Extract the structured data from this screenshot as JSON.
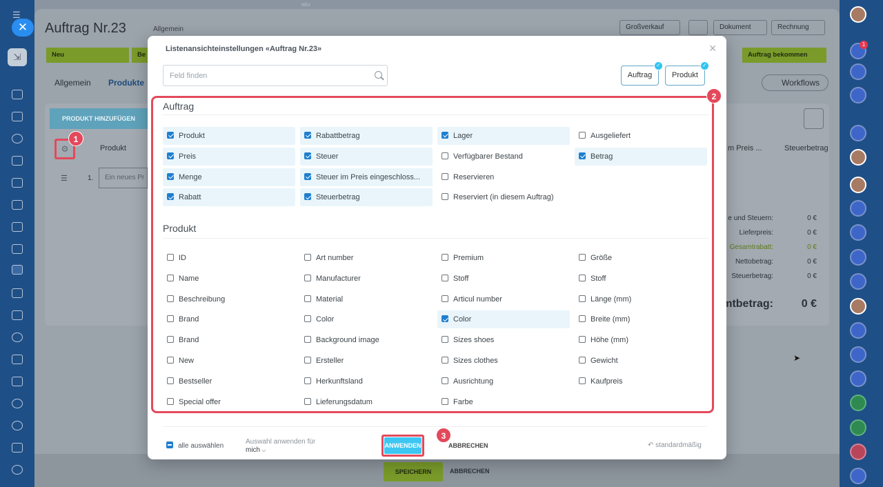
{
  "page": {
    "title": "Auftrag Nr.23",
    "category": "Allgemein",
    "top_center": "NEU",
    "pipeline": "Großverkauf",
    "document": "Dokument",
    "invoice": "Rechnung",
    "stages": [
      "Neu",
      "Be",
      "Auftrag bekommen"
    ],
    "tabs": [
      "Allgemein",
      "Produkte"
    ],
    "workflows": "Workflows",
    "add_product": "PRODUKT HINZUFÜGEN",
    "col_product": "Produkt",
    "col_price": "m Preis ...",
    "col_tax": "Steuerbetrag",
    "row_number": "1.",
    "row_placeholder": "Ein neues Pr",
    "summary": [
      {
        "label": "e und Steuern:",
        "value": "0 €"
      },
      {
        "label": "Lieferpreis:",
        "value": "0 €"
      },
      {
        "label": "Gesamtrabatt:",
        "value": "0 €"
      },
      {
        "label": "Nettobetrag:",
        "value": "0 €"
      },
      {
        "label": "Steuerbetrag:",
        "value": "0 €"
      }
    ],
    "total_label": "mtbetrag:",
    "total_value": "0 €",
    "save": "SPEICHERN",
    "cancel": "ABBRECHEN"
  },
  "modal": {
    "title": "Listenansichteinstellungen «Auftrag Nr.23»",
    "search_placeholder": "Feld finden",
    "tag_buttons": [
      "Auftrag",
      "Produkt"
    ],
    "sections": [
      {
        "title": "Auftrag",
        "items": [
          {
            "label": "Produkt",
            "checked": true
          },
          {
            "label": "Rabattbetrag",
            "checked": true
          },
          {
            "label": "Lager",
            "checked": true
          },
          {
            "label": "Ausgeliefert",
            "checked": false
          },
          {
            "label": "Preis",
            "checked": true
          },
          {
            "label": "Steuer",
            "checked": true
          },
          {
            "label": "Verfügbarer Bestand",
            "checked": false
          },
          {
            "label": "Betrag",
            "checked": true
          },
          {
            "label": "Menge",
            "checked": true
          },
          {
            "label": "Steuer im Preis eingeschloss...",
            "checked": true
          },
          {
            "label": "Reservieren",
            "checked": false
          },
          {
            "label": "",
            "checked": false
          },
          {
            "label": "Rabatt",
            "checked": true
          },
          {
            "label": "Steuerbetrag",
            "checked": true
          },
          {
            "label": "Reserviert (in diesem Auftrag)",
            "checked": false
          }
        ]
      },
      {
        "title": "Produkt",
        "items": [
          {
            "label": "ID",
            "checked": false
          },
          {
            "label": "Art number",
            "checked": false
          },
          {
            "label": "Premium",
            "checked": false
          },
          {
            "label": "Größe",
            "checked": false
          },
          {
            "label": "Name",
            "checked": false
          },
          {
            "label": "Manufacturer",
            "checked": false
          },
          {
            "label": "Stoff",
            "checked": false
          },
          {
            "label": "Stoff",
            "checked": false
          },
          {
            "label": "Beschreibung",
            "checked": false
          },
          {
            "label": "Material",
            "checked": false
          },
          {
            "label": "Articul number",
            "checked": false
          },
          {
            "label": "Länge (mm)",
            "checked": false
          },
          {
            "label": "Brand",
            "checked": false
          },
          {
            "label": "Color",
            "checked": false
          },
          {
            "label": "Color",
            "checked": true
          },
          {
            "label": "Breite (mm)",
            "checked": false
          },
          {
            "label": "Brand",
            "checked": false
          },
          {
            "label": "Background image",
            "checked": false
          },
          {
            "label": "Sizes shoes",
            "checked": false
          },
          {
            "label": "Höhe (mm)",
            "checked": false
          },
          {
            "label": "New",
            "checked": false
          },
          {
            "label": "Ersteller",
            "checked": false
          },
          {
            "label": "Sizes clothes",
            "checked": false
          },
          {
            "label": "Gewicht",
            "checked": false
          },
          {
            "label": "Bestseller",
            "checked": false
          },
          {
            "label": "Herkunftsland",
            "checked": false
          },
          {
            "label": "Ausrichtung",
            "checked": false
          },
          {
            "label": "Kaufpreis",
            "checked": false
          },
          {
            "label": "Special offer",
            "checked": false
          },
          {
            "label": "Lieferungsdatum",
            "checked": false
          },
          {
            "label": "Farbe",
            "checked": false
          }
        ]
      }
    ],
    "select_all": "alle auswählen",
    "apply_for_label": "Auswahl anwenden für",
    "apply_for_value": "mich",
    "apply": "ANWENDEN",
    "cancel": "ABBRECHEN",
    "default": "standardmäßig"
  },
  "badges": [
    "1",
    "2",
    "3"
  ],
  "notification_count": "1",
  "colors": {
    "accent": "#3cc6f2",
    "highlight": "#e3495b",
    "checkbox": "#1f7fcf"
  }
}
